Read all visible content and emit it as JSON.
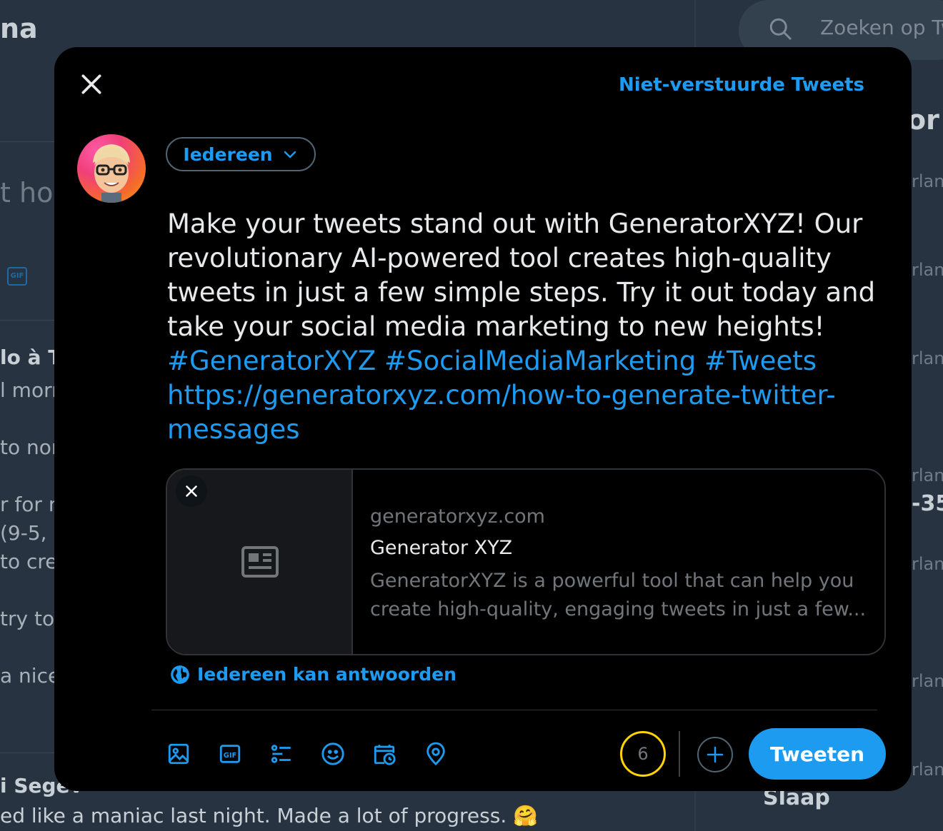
{
  "background": {
    "header_fragment": "na",
    "search_placeholder": "Zoeken op Tw",
    "compose_placeholder_fragment": "t hou",
    "gif_label": "GIF",
    "timeline_fragments": [
      "lo à Te",
      "l morn",
      "to nor",
      "r for no",
      "(9-5,",
      "to cre",
      "try to",
      "a nice"
    ],
    "last_tweet_user_fragment": "i Segev",
    "last_tweet_text": "ed like a maniac last night. Made a lot of progress. 🤗",
    "sidebar_heading_fragment": "or j",
    "sidebar_trend_fragments": [
      "rland",
      "rland",
      "rland",
      "rland",
      "rland",
      "rland",
      "rland"
    ],
    "sidebar_number_fragment": "-35",
    "sidebar_bottom": "Slaap"
  },
  "modal": {
    "unsent_tweets_link": "Niet-verstuurde Tweets",
    "audience_label": "Iedereen",
    "tweet_text_plain": "Make your tweets stand out with GeneratorXYZ! Our revolutionary AI-powered tool creates high-quality tweets in just a few simple steps. Try it out today and take your social media marketing to new heights!",
    "hashtags": "#GeneratorXYZ #SocialMediaMarketing #Tweets",
    "url": "https://generatorxyz.com/how-to-generate-twitter-messages",
    "link_card": {
      "domain": "generatorxyz.com",
      "title": "Generator XYZ",
      "description": "GeneratorXYZ is a powerful tool that can help you create high-quality, engaging tweets in just a few..."
    },
    "reply_setting": "Iedereen kan antwoorden",
    "char_counter": "6",
    "tweet_button": "Tweeten"
  },
  "colors": {
    "accent": "#1d9bf0",
    "counter_ring": "#ffd400",
    "modal_bg": "#000000",
    "backdrop": "#273340"
  },
  "icons": [
    "close-icon",
    "chevron-down-icon",
    "article-icon",
    "globe-icon",
    "image-icon",
    "gif-icon",
    "poll-icon",
    "emoji-icon",
    "schedule-icon",
    "location-icon",
    "plus-icon",
    "search-icon"
  ]
}
